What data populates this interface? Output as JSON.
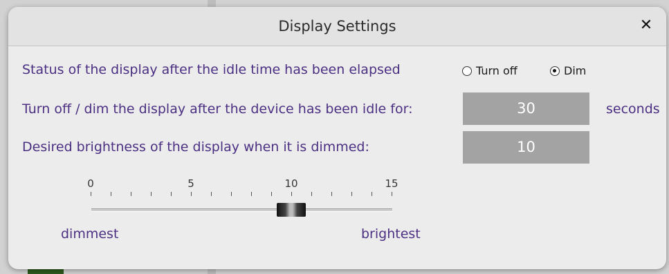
{
  "dialog": {
    "title": "Display Settings",
    "close_label": "✕"
  },
  "rows": {
    "status_label": "Status of the display after the idle time has been elapsed",
    "idle_label": "Turn off / dim the display after the device has been idle for:",
    "brightness_label": "Desired brightness of the display when it is dimmed:"
  },
  "status_options": [
    {
      "label": "Turn off",
      "selected": false
    },
    {
      "label": "Dim",
      "selected": true
    }
  ],
  "idle_time": {
    "value": "30",
    "unit": "seconds"
  },
  "brightness": {
    "value": "10"
  },
  "slider": {
    "min": 0,
    "max": 15,
    "value": 10,
    "tick_labels": [
      "0",
      "5",
      "10",
      "15"
    ],
    "min_label": "dimmest",
    "max_label": "brightest"
  },
  "colors": {
    "label_text": "#4b2f82",
    "input_bg": "#a3a3a3"
  }
}
